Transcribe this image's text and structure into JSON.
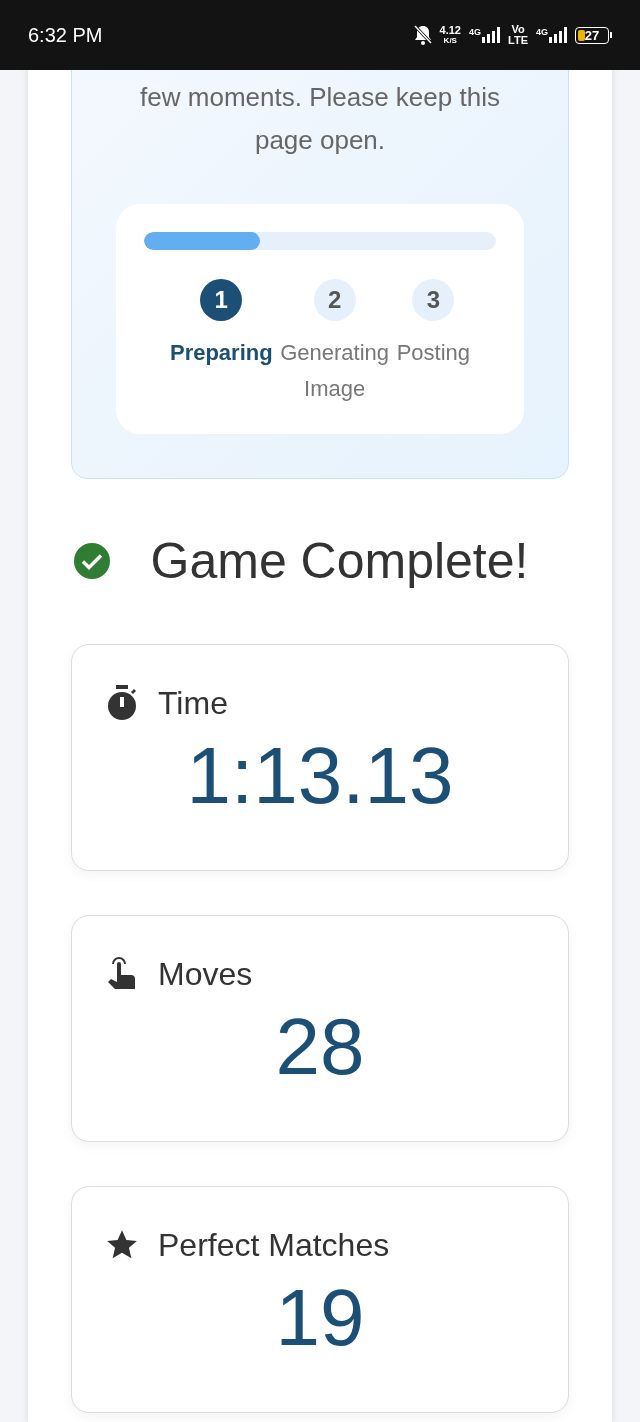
{
  "status_bar": {
    "time": "6:32 PM",
    "speed_value": "4.12",
    "speed_unit": "K/S",
    "network_1": "4G",
    "volte_top": "Vo",
    "volte_bottom": "LTE",
    "network_2": "4G",
    "battery": "27"
  },
  "processing": {
    "message": "few moments. Please keep this page open.",
    "level": 0.33,
    "steps": [
      {
        "number": "1",
        "label": "Preparing",
        "active": true
      },
      {
        "number": "2",
        "label": "Generating Image",
        "active": false
      },
      {
        "number": "3",
        "label": "Posting",
        "active": false
      }
    ]
  },
  "heading": "Game Complete!",
  "stats": [
    {
      "kind": "timer",
      "label": "Time",
      "value": "1:13.13"
    },
    {
      "kind": "tap",
      "label": "Moves",
      "value": "28"
    },
    {
      "kind": "star",
      "label": "Perfect Matches",
      "value": "19"
    }
  ]
}
